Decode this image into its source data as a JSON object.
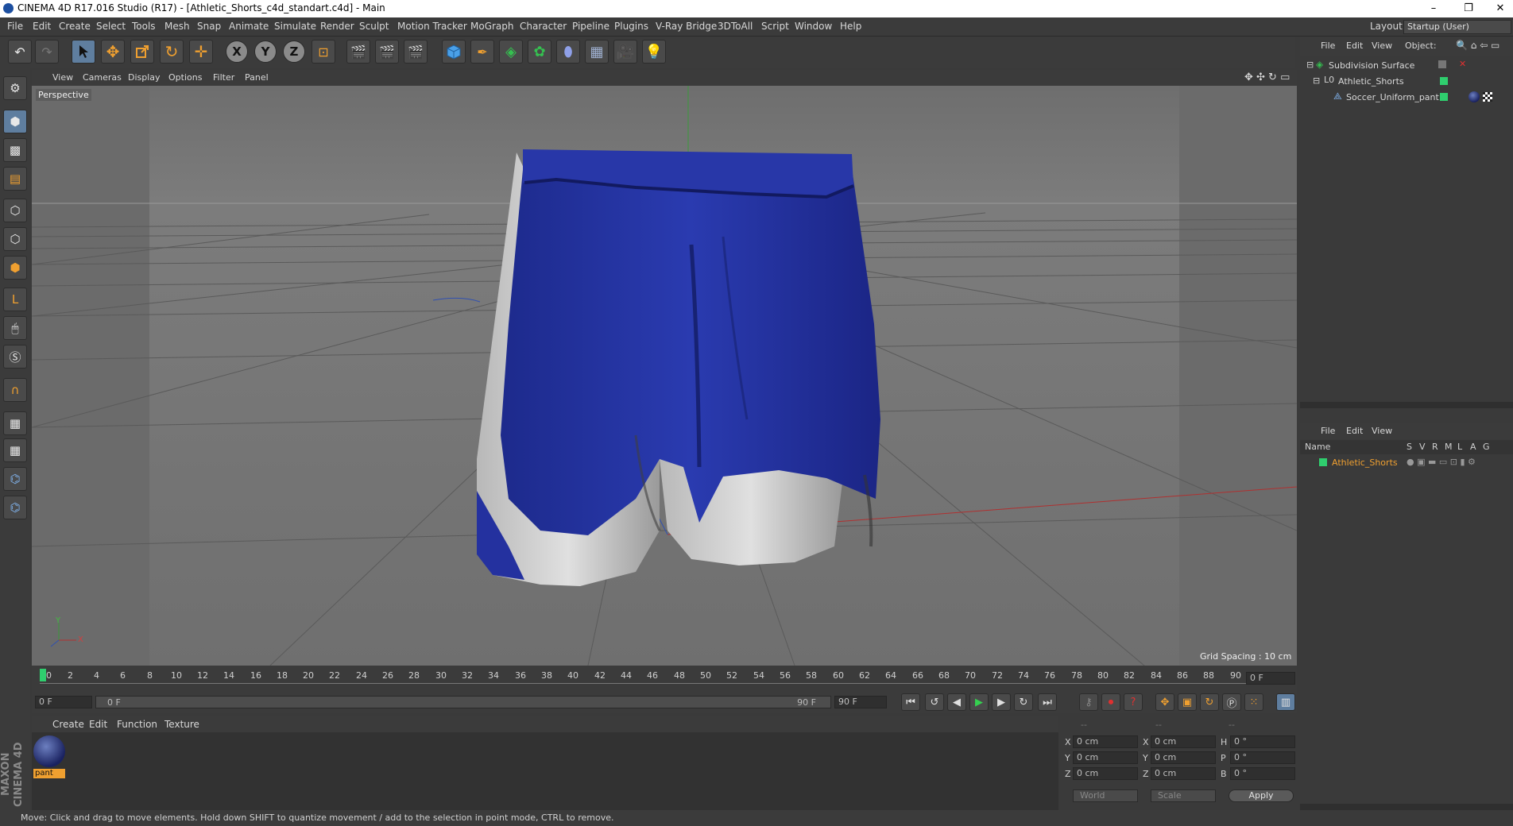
{
  "window": {
    "title": "CINEMA 4D R17.016 Studio (R17) - [Athletic_Shorts_c4d_standart.c4d] - Main",
    "minimize": "–",
    "restore": "❐",
    "close": "✕"
  },
  "menubar": {
    "items": [
      "File",
      "Edit",
      "Create",
      "Select",
      "Tools",
      "Mesh",
      "Snap",
      "Animate",
      "Simulate",
      "Render",
      "Sculpt",
      "Motion Tracker",
      "MoGraph",
      "Character",
      "Pipeline",
      "Plugins",
      "V-Ray Bridge",
      "3DToAll",
      "Script",
      "Window",
      "Help"
    ],
    "layout_label": "Layout:",
    "layout_value": "Startup (User)"
  },
  "toolbar": {
    "undo": "↶",
    "redo": "↷",
    "x_label": "X",
    "y_label": "Y",
    "z_label": "Z"
  },
  "viewport": {
    "menu": [
      "View",
      "Cameras",
      "Display",
      "Options",
      "Filter",
      "Panel"
    ],
    "label": "Perspective",
    "grid_spacing": "Grid Spacing : 10 cm",
    "axis_y": "Y",
    "axis_x": "X",
    "colors": {
      "shorts_blue": "#23309f",
      "shorts_white": "#d9d9d9",
      "background": "#7a7a7a"
    }
  },
  "timeline": {
    "ticks": [
      "0",
      "2",
      "4",
      "6",
      "8",
      "10",
      "12",
      "14",
      "16",
      "18",
      "20",
      "22",
      "24",
      "26",
      "28",
      "30",
      "32",
      "34",
      "36",
      "38",
      "40",
      "42",
      "44",
      "46",
      "48",
      "50",
      "52",
      "54",
      "56",
      "58",
      "60",
      "62",
      "64",
      "66",
      "68",
      "70",
      "72",
      "74",
      "76",
      "78",
      "80",
      "82",
      "84",
      "86",
      "88",
      "90"
    ],
    "current_frame_field": "0 F",
    "start_field": "0 F",
    "range_start": "0 F",
    "range_end": "90 F",
    "end_field": "90 F"
  },
  "material_manager": {
    "menu": [
      "Create",
      "Edit",
      "Function",
      "Texture"
    ],
    "materials": [
      {
        "name": "pant"
      }
    ]
  },
  "coordinates": {
    "header": [
      "--",
      "--",
      "--"
    ],
    "rows": [
      {
        "a": "X",
        "av": "0 cm",
        "b": "X",
        "bv": "0 cm",
        "c": "H",
        "cv": "0 °"
      },
      {
        "a": "Y",
        "av": "0 cm",
        "b": "Y",
        "bv": "0 cm",
        "c": "P",
        "cv": "0 °"
      },
      {
        "a": "Z",
        "av": "0 cm",
        "b": "Z",
        "bv": "0 cm",
        "c": "B",
        "cv": "0 °"
      }
    ],
    "world": "World",
    "scale": "Scale",
    "apply": "Apply"
  },
  "object_manager": {
    "menu": [
      "File",
      "Edit",
      "View",
      "Object:"
    ],
    "objects": [
      {
        "name": "Subdivision Surface",
        "indent": 0
      },
      {
        "name": "Athletic_Shorts",
        "indent": 1
      },
      {
        "name": "Soccer_Uniform_pant",
        "indent": 2
      }
    ]
  },
  "layer_manager": {
    "menu": [
      "File",
      "Edit",
      "View"
    ],
    "columns": [
      "Name",
      "S",
      "V",
      "R",
      "M",
      "L",
      "A",
      "G"
    ],
    "layers": [
      {
        "name": "Athletic_Shorts"
      }
    ]
  },
  "status": "Move: Click and drag to move elements. Hold down SHIFT to quantize movement / add to the selection in point mode, CTRL to remove.",
  "branding": "MAXON CINEMA 4D"
}
